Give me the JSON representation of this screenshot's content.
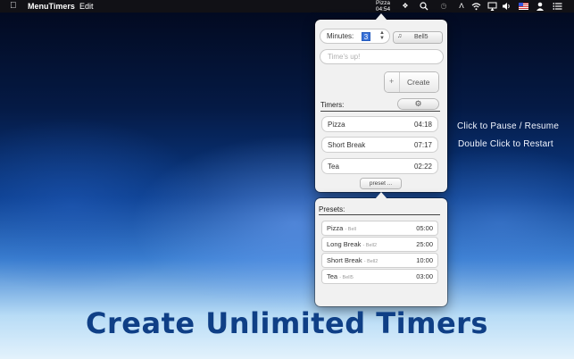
{
  "menubar": {
    "app_name": "MenuTimers",
    "edit_menu": "Edit",
    "timer_status_name": "Pizza",
    "timer_status_time": "04:54",
    "icons": [
      "apple-icon",
      "timer-status",
      "dropbox-icon",
      "spotlight-search-icon",
      "time-machine-icon",
      "bluetooth-icon",
      "wifi-icon",
      "airplay-icon",
      "volume-icon",
      "us-flag-icon",
      "user-icon",
      "list-icon"
    ]
  },
  "create_panel": {
    "minutes_label": "Minutes:",
    "minutes_value": "3",
    "sound_name": "Bell5",
    "message_placeholder": "Time's up!",
    "create_label": "Create"
  },
  "timers": {
    "title": "Timers:",
    "items": [
      {
        "name": "Pizza",
        "time": "04:18"
      },
      {
        "name": "Short Break",
        "time": "07:17"
      },
      {
        "name": "Tea",
        "time": "02:22"
      }
    ],
    "preset_button": "preset ..."
  },
  "presets": {
    "title": "Presets:",
    "items": [
      {
        "name": "Pizza",
        "sound": "- Bell",
        "time": "05:00"
      },
      {
        "name": "Long Break",
        "sound": "- Bell2",
        "time": "25:00"
      },
      {
        "name": "Short Break",
        "sound": "- Bell2",
        "time": "10:00"
      },
      {
        "name": "Tea",
        "sound": "- Bell5",
        "time": "03:00"
      }
    ]
  },
  "hints": {
    "pause": "Click to Pause / Resume",
    "restart": "Double Click to Restart"
  },
  "headline": "Create Unlimited Timers",
  "colors": {
    "headline": "#0f3f86",
    "selection": "#3b73d8",
    "panel": "#f1f1f1"
  }
}
